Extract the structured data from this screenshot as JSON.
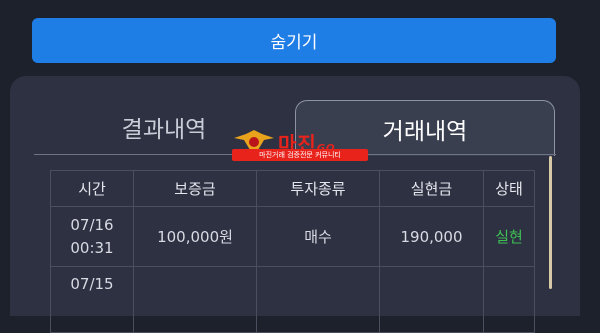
{
  "hide_button": {
    "label": "숨기기"
  },
  "tabs": [
    {
      "label": "결과내역",
      "active": false
    },
    {
      "label": "거래내역",
      "active": true
    }
  ],
  "watermark": {
    "title": "마진",
    "tag": "GO",
    "subtitle": "마진거래 검증전문 커뮤니티"
  },
  "table": {
    "headers": [
      "시간",
      "보증금",
      "투자종류",
      "실현금",
      "상태"
    ],
    "rows": [
      {
        "date": "07/16",
        "time": "00:31",
        "deposit": "100,000원",
        "type": "매수",
        "realized": "190,000",
        "status": "실현"
      },
      {
        "date": "07/15",
        "time": "",
        "deposit": "",
        "type": "",
        "realized": "",
        "status": ""
      }
    ]
  },
  "colors": {
    "accent": "#1f7de6",
    "status_realized": "#3fbf55",
    "watermark_red": "#e8231c"
  }
}
